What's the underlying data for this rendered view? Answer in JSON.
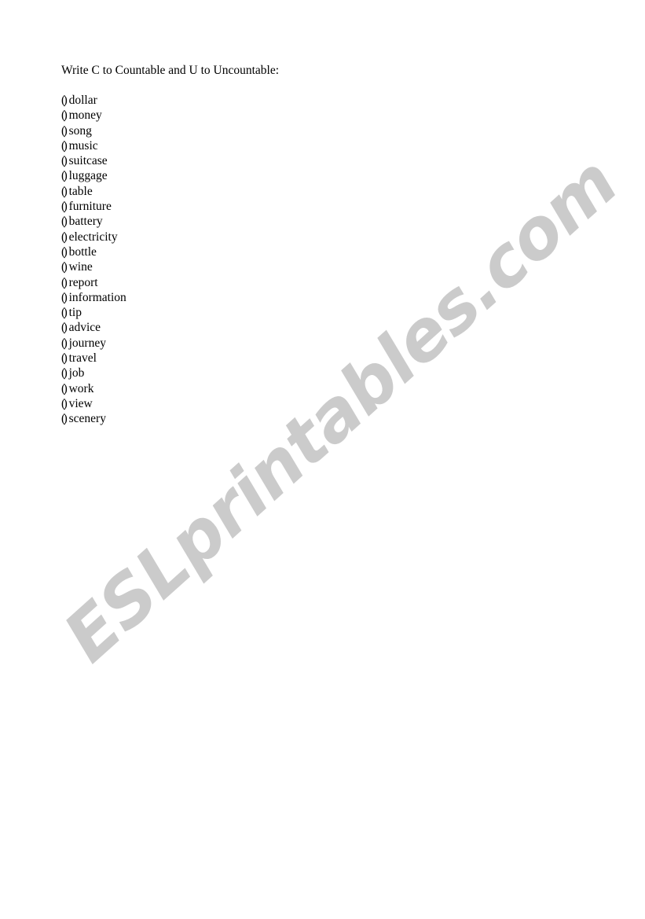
{
  "document": {
    "background_color": "#ffffff",
    "text_color": "#000000",
    "heading": "Write C to Countable and U to Uncountable:",
    "answer_blank": "( )",
    "items": [
      "dollar",
      "money",
      "song",
      "music",
      "suitcase",
      "luggage",
      "table",
      "furniture",
      "battery",
      "electricity",
      "bottle",
      "wine",
      "report",
      "information",
      "tip",
      "advice",
      "journey",
      "travel",
      "job",
      "work",
      "view",
      "scenery"
    ]
  },
  "watermark": {
    "text": "ESLprintables.com",
    "color": "#cbcbcb",
    "rotation_degrees": -41.9
  }
}
